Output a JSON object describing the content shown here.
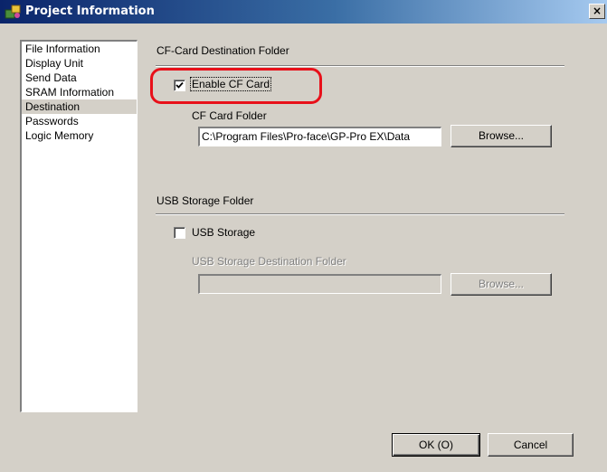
{
  "window": {
    "title": "Project Information",
    "close_glyph": "×",
    "icon": "project-info-icon"
  },
  "nav": {
    "items": [
      {
        "label": "File Information",
        "selected": false
      },
      {
        "label": "Display Unit",
        "selected": false
      },
      {
        "label": "Send Data",
        "selected": false
      },
      {
        "label": "SRAM Information",
        "selected": false
      },
      {
        "label": "Destination",
        "selected": true
      },
      {
        "label": "Passwords",
        "selected": false
      },
      {
        "label": "Logic Memory",
        "selected": false
      }
    ]
  },
  "cf_card": {
    "group_label": "CF-Card Destination Folder",
    "enable_label": "Enable CF Card",
    "enabled": true,
    "folder_label": "CF Card Folder",
    "folder_value": "C:\\Program Files\\Pro-face\\GP-Pro EX\\Data",
    "browse_label": "Browse..."
  },
  "usb": {
    "group_label": "USB Storage Folder",
    "enable_label": "USB Storage",
    "enabled": false,
    "folder_label": "USB Storage Destination Folder",
    "folder_value": "",
    "browse_label": "Browse..."
  },
  "footer": {
    "ok_label": "OK (O)",
    "cancel_label": "Cancel"
  },
  "colors": {
    "annotation_highlight": "#e8101a",
    "titlebar_start": "#0a246a",
    "titlebar_end": "#a6caf0"
  }
}
